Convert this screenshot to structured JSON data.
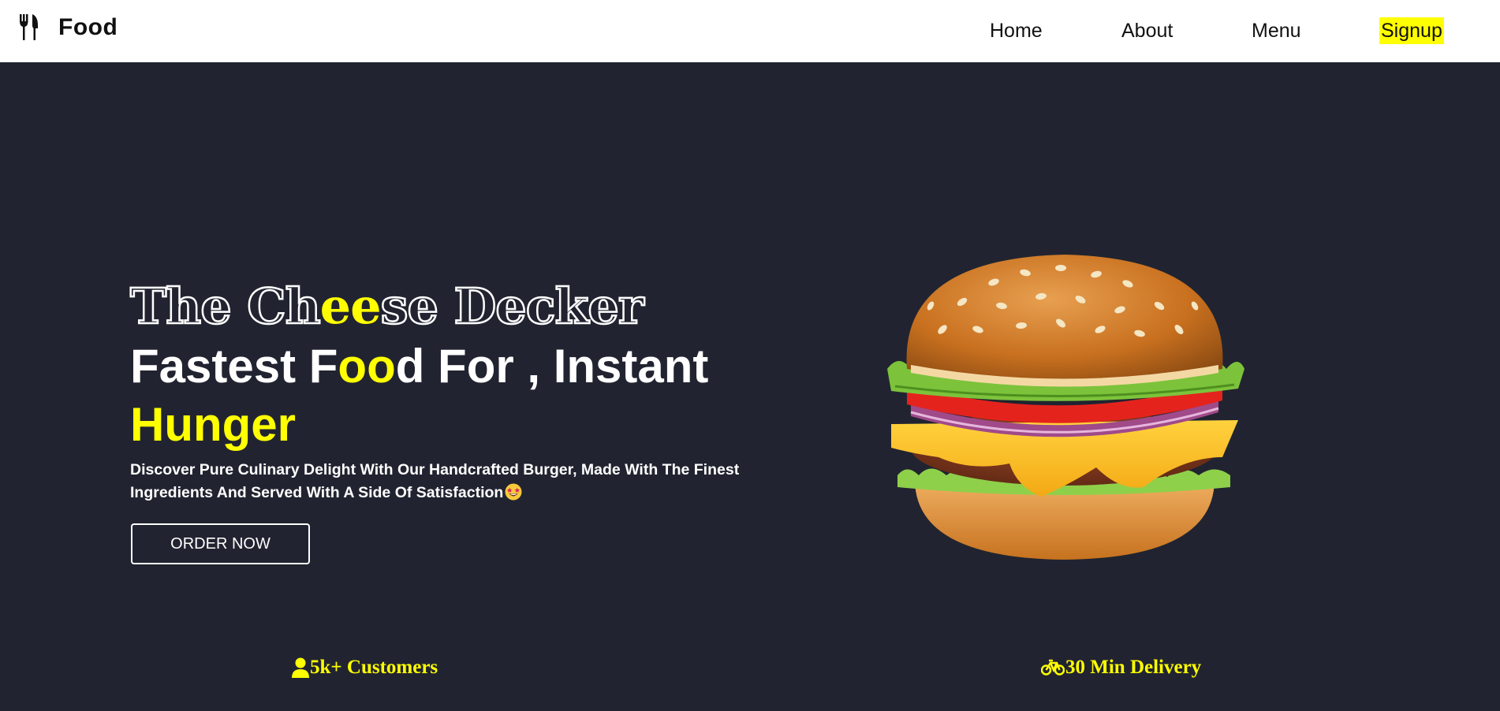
{
  "brand": {
    "name": "Food",
    "icon": "fork-knife-icon"
  },
  "nav": {
    "home": "Home",
    "about": "About",
    "menu": "Menu",
    "signup": "Signup"
  },
  "hero": {
    "title": {
      "part1": "The Ch",
      "highlight": "ee",
      "part2": "se Decker"
    },
    "subtitle": {
      "part1": "Fastest F",
      "highlight": "oo",
      "part2": "d For , Instant",
      "part3": "Hunger"
    },
    "description": "Discover Pure Culinary Delight With Our Handcrafted Burger, Made With The Finest Ingredients And Served With A Side Of Satisfaction",
    "emoji": "star-struck-emoji",
    "cta": "ORDER NOW",
    "image": "burger-image"
  },
  "stats": {
    "customers": {
      "label": "5k+ Customers",
      "icon": "user-icon"
    },
    "delivery": {
      "label": "30 Min Delivery",
      "icon": "bicycle-icon"
    }
  },
  "colors": {
    "accent": "#ffff00",
    "background": "#212430",
    "navbar": "#ffffff"
  }
}
